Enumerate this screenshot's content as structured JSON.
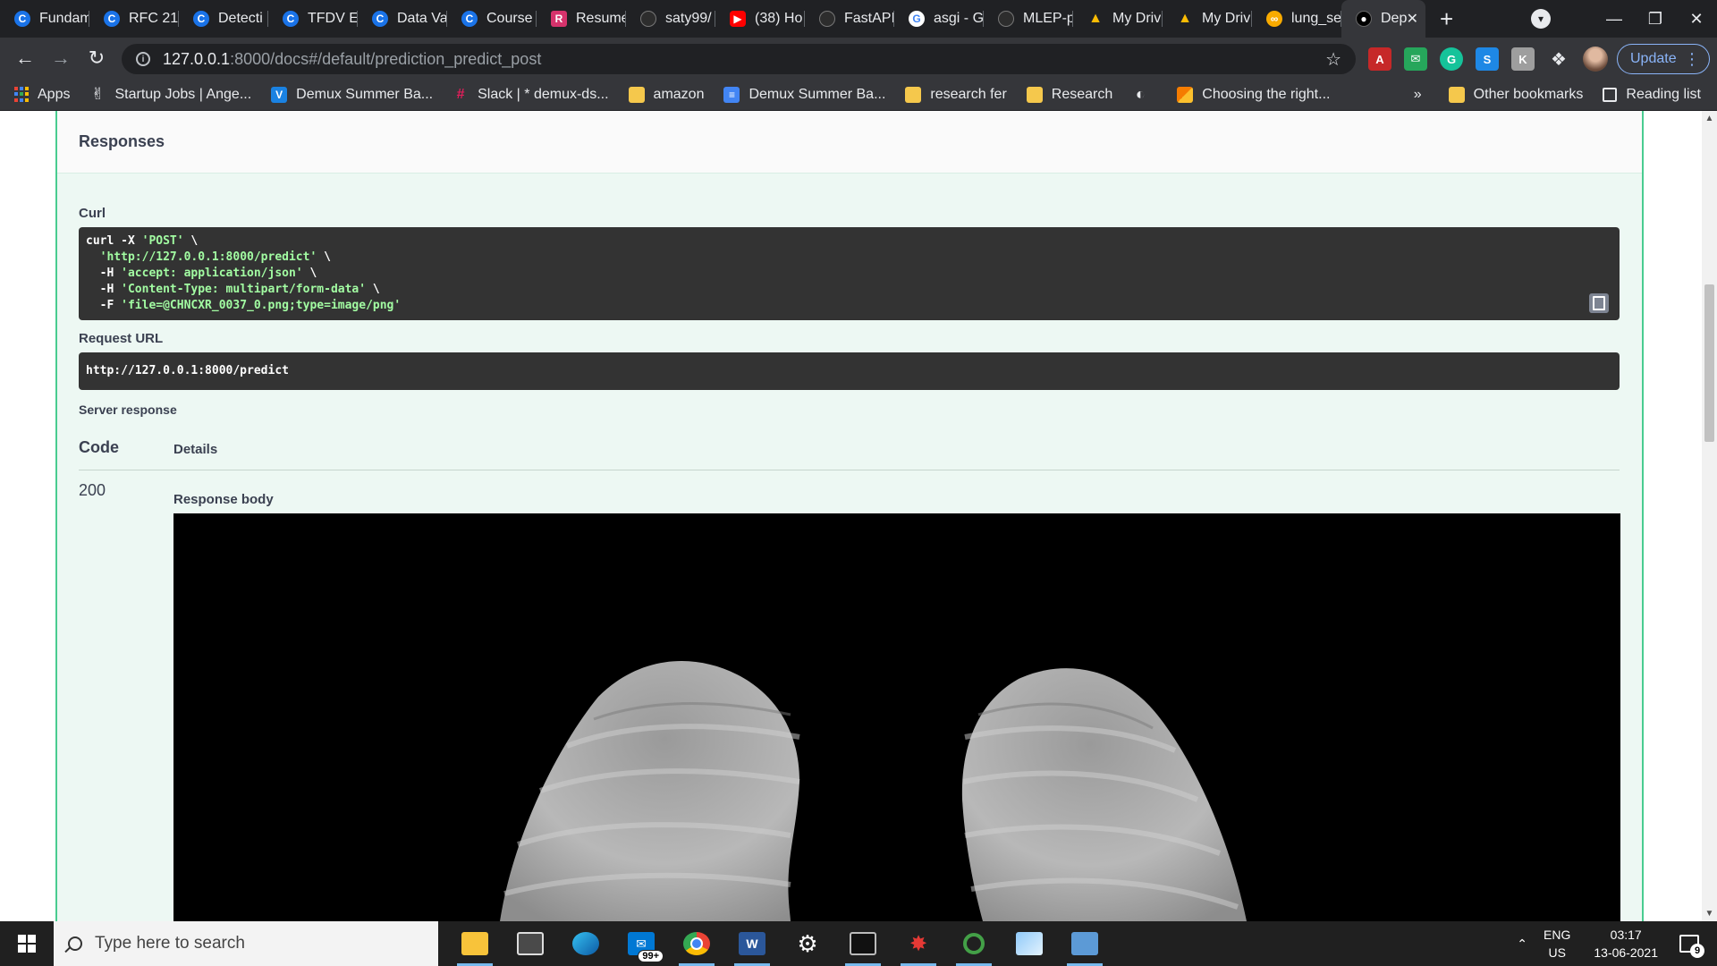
{
  "browser": {
    "tabs": [
      {
        "label": "Fundam",
        "icon": "coursera-icon"
      },
      {
        "label": "RFC 21!",
        "icon": "coursera-icon"
      },
      {
        "label": "Detecti",
        "icon": "coursera-icon"
      },
      {
        "label": "TFDV E",
        "icon": "coursera-icon"
      },
      {
        "label": "Data Va",
        "icon": "coursera-icon"
      },
      {
        "label": "Course",
        "icon": "coursera-icon"
      },
      {
        "label": "Resume",
        "icon": "resume-icon"
      },
      {
        "label": "saty99/",
        "icon": "github-icon"
      },
      {
        "label": "(38) Ho",
        "icon": "youtube-icon"
      },
      {
        "label": "FastAPI",
        "icon": "github-icon"
      },
      {
        "label": "asgi - G",
        "icon": "google-icon"
      },
      {
        "label": "MLEP-p",
        "icon": "github-icon"
      },
      {
        "label": "My Driv",
        "icon": "drive-icon"
      },
      {
        "label": "My Driv",
        "icon": "drive-icon"
      },
      {
        "label": "lung_se",
        "icon": "colab-icon"
      },
      {
        "label": "Dep",
        "icon": "deploy-icon",
        "active": true
      }
    ],
    "new_tab": "+",
    "url_host": "127.0.0.1",
    "url_path": ":8000/docs#/default/prediction_predict_post",
    "update_label": "Update",
    "bookmarks": [
      {
        "label": "Apps",
        "icon": "apps-grid-icon"
      },
      {
        "label": "Startup Jobs | Ange...",
        "icon": "angellist-icon"
      },
      {
        "label": "Demux Summer Ba...",
        "icon": "vimeo-icon"
      },
      {
        "label": "Slack | * demux-ds...",
        "icon": "slack-icon"
      },
      {
        "label": "amazon",
        "icon": "folder-icon"
      },
      {
        "label": "Demux Summer Ba...",
        "icon": "docs-icon"
      },
      {
        "label": "research fer",
        "icon": "folder-icon"
      },
      {
        "label": "Research",
        "icon": "folder-icon"
      },
      {
        "label": "",
        "icon": "globe-icon"
      },
      {
        "label": "Choosing the right...",
        "icon": "article-icon"
      }
    ],
    "bookmarks_more": "»",
    "other_bookmarks": "Other bookmarks",
    "reading_list": "Reading list"
  },
  "page": {
    "responses_title": "Responses",
    "curl_label": "Curl",
    "curl_lines": [
      {
        "kw": "curl -X ",
        "str": "'POST'",
        "tail": " \\"
      },
      {
        "kw": "  ",
        "str": "'http://127.0.0.1:8000/predict'",
        "tail": " \\"
      },
      {
        "kw": "  -H ",
        "str": "'accept: application/json'",
        "tail": " \\"
      },
      {
        "kw": "  -H ",
        "str": "'Content-Type: multipart/form-data'",
        "tail": " \\"
      },
      {
        "kw": "  -F ",
        "str": "'file=@CHNCXR_0037_0.png;type=image/png'",
        "tail": ""
      }
    ],
    "request_url_label": "Request URL",
    "request_url": "http://127.0.0.1:8000/predict",
    "server_response_label": "Server response",
    "code_header": "Code",
    "details_header": "Details",
    "status_code": "200",
    "response_body_label": "Response body"
  },
  "taskbar": {
    "search_placeholder": "Type here to search",
    "mail_badge": "99+",
    "lang_line1": "ENG",
    "lang_line2": "US",
    "time": "03:17",
    "date": "13-06-2021",
    "notification_count": "9"
  }
}
